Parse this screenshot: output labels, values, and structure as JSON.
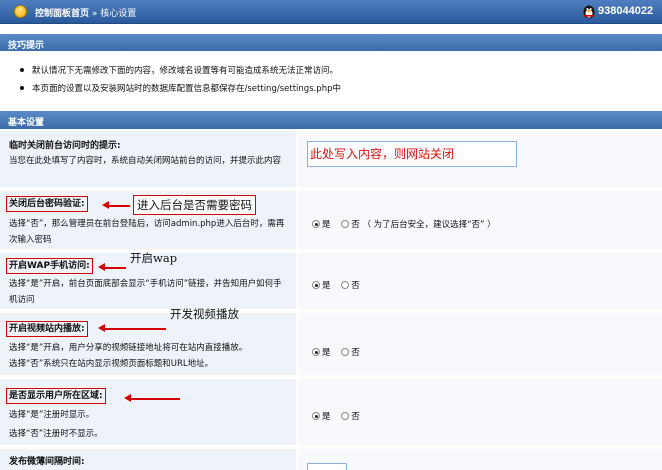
{
  "header": {
    "home": "控制面板首页",
    "separator": "»",
    "current": "核心设置",
    "user_id": "938044022"
  },
  "tips": {
    "title": "技巧提示",
    "items": [
      "默认情况下无需修改下面的内容，修改域名设置等有可能造成系统无法正常访问。",
      "本页面的设置以及安装网站时的数据库配置信息都保存在/setting/settings.php中"
    ]
  },
  "settings": {
    "title": "基本设置",
    "close_site": {
      "label": "临时关闭前台访问时的提示:",
      "desc": "当您在此处填写了内容时，系统自动关闭网站前台的访问，并提示此内容",
      "value": "此处写入内容，则网站关闭"
    },
    "admin_password": {
      "label": "关闭后台密码验证:",
      "desc": "选择“否”，那么管理员在前台登陆后，访问admin.php进入后台时，需再次输入密码",
      "yes": "是",
      "no": "否",
      "hint": "（ 为了后台安全，建议选择“否” ）"
    },
    "wap": {
      "label": "开启WAP手机访问:",
      "desc": "选择“是”开启，前台页面底部会显示“手机访问”链接，并告知用户如何手机访问",
      "yes": "是",
      "no": "否"
    },
    "video": {
      "label": "开启视频站内播放:",
      "desc1": "选择“是”开启，用户分享的视频链接地址将可在站内直接播放。",
      "desc2": "选择“否”系统只在站内显示视频页面标题和URL地址。",
      "yes": "是",
      "no": "否"
    },
    "region": {
      "label": "是否显示用户所在区域:",
      "desc1": "选择“是”注册时显示。",
      "desc2": "选择“否”注册时不显示。",
      "yes": "是",
      "no": "否"
    },
    "weibo": {
      "label": "发布微薄间隔时间:"
    }
  },
  "annotations": {
    "password": "进入后台是否需要密码",
    "wap": "开启wap",
    "video": "开发视频播放"
  },
  "colors": {
    "header_bg": "#3a6aa8",
    "row_bg": "#eef3fa",
    "annotation_red": "#d40000"
  }
}
